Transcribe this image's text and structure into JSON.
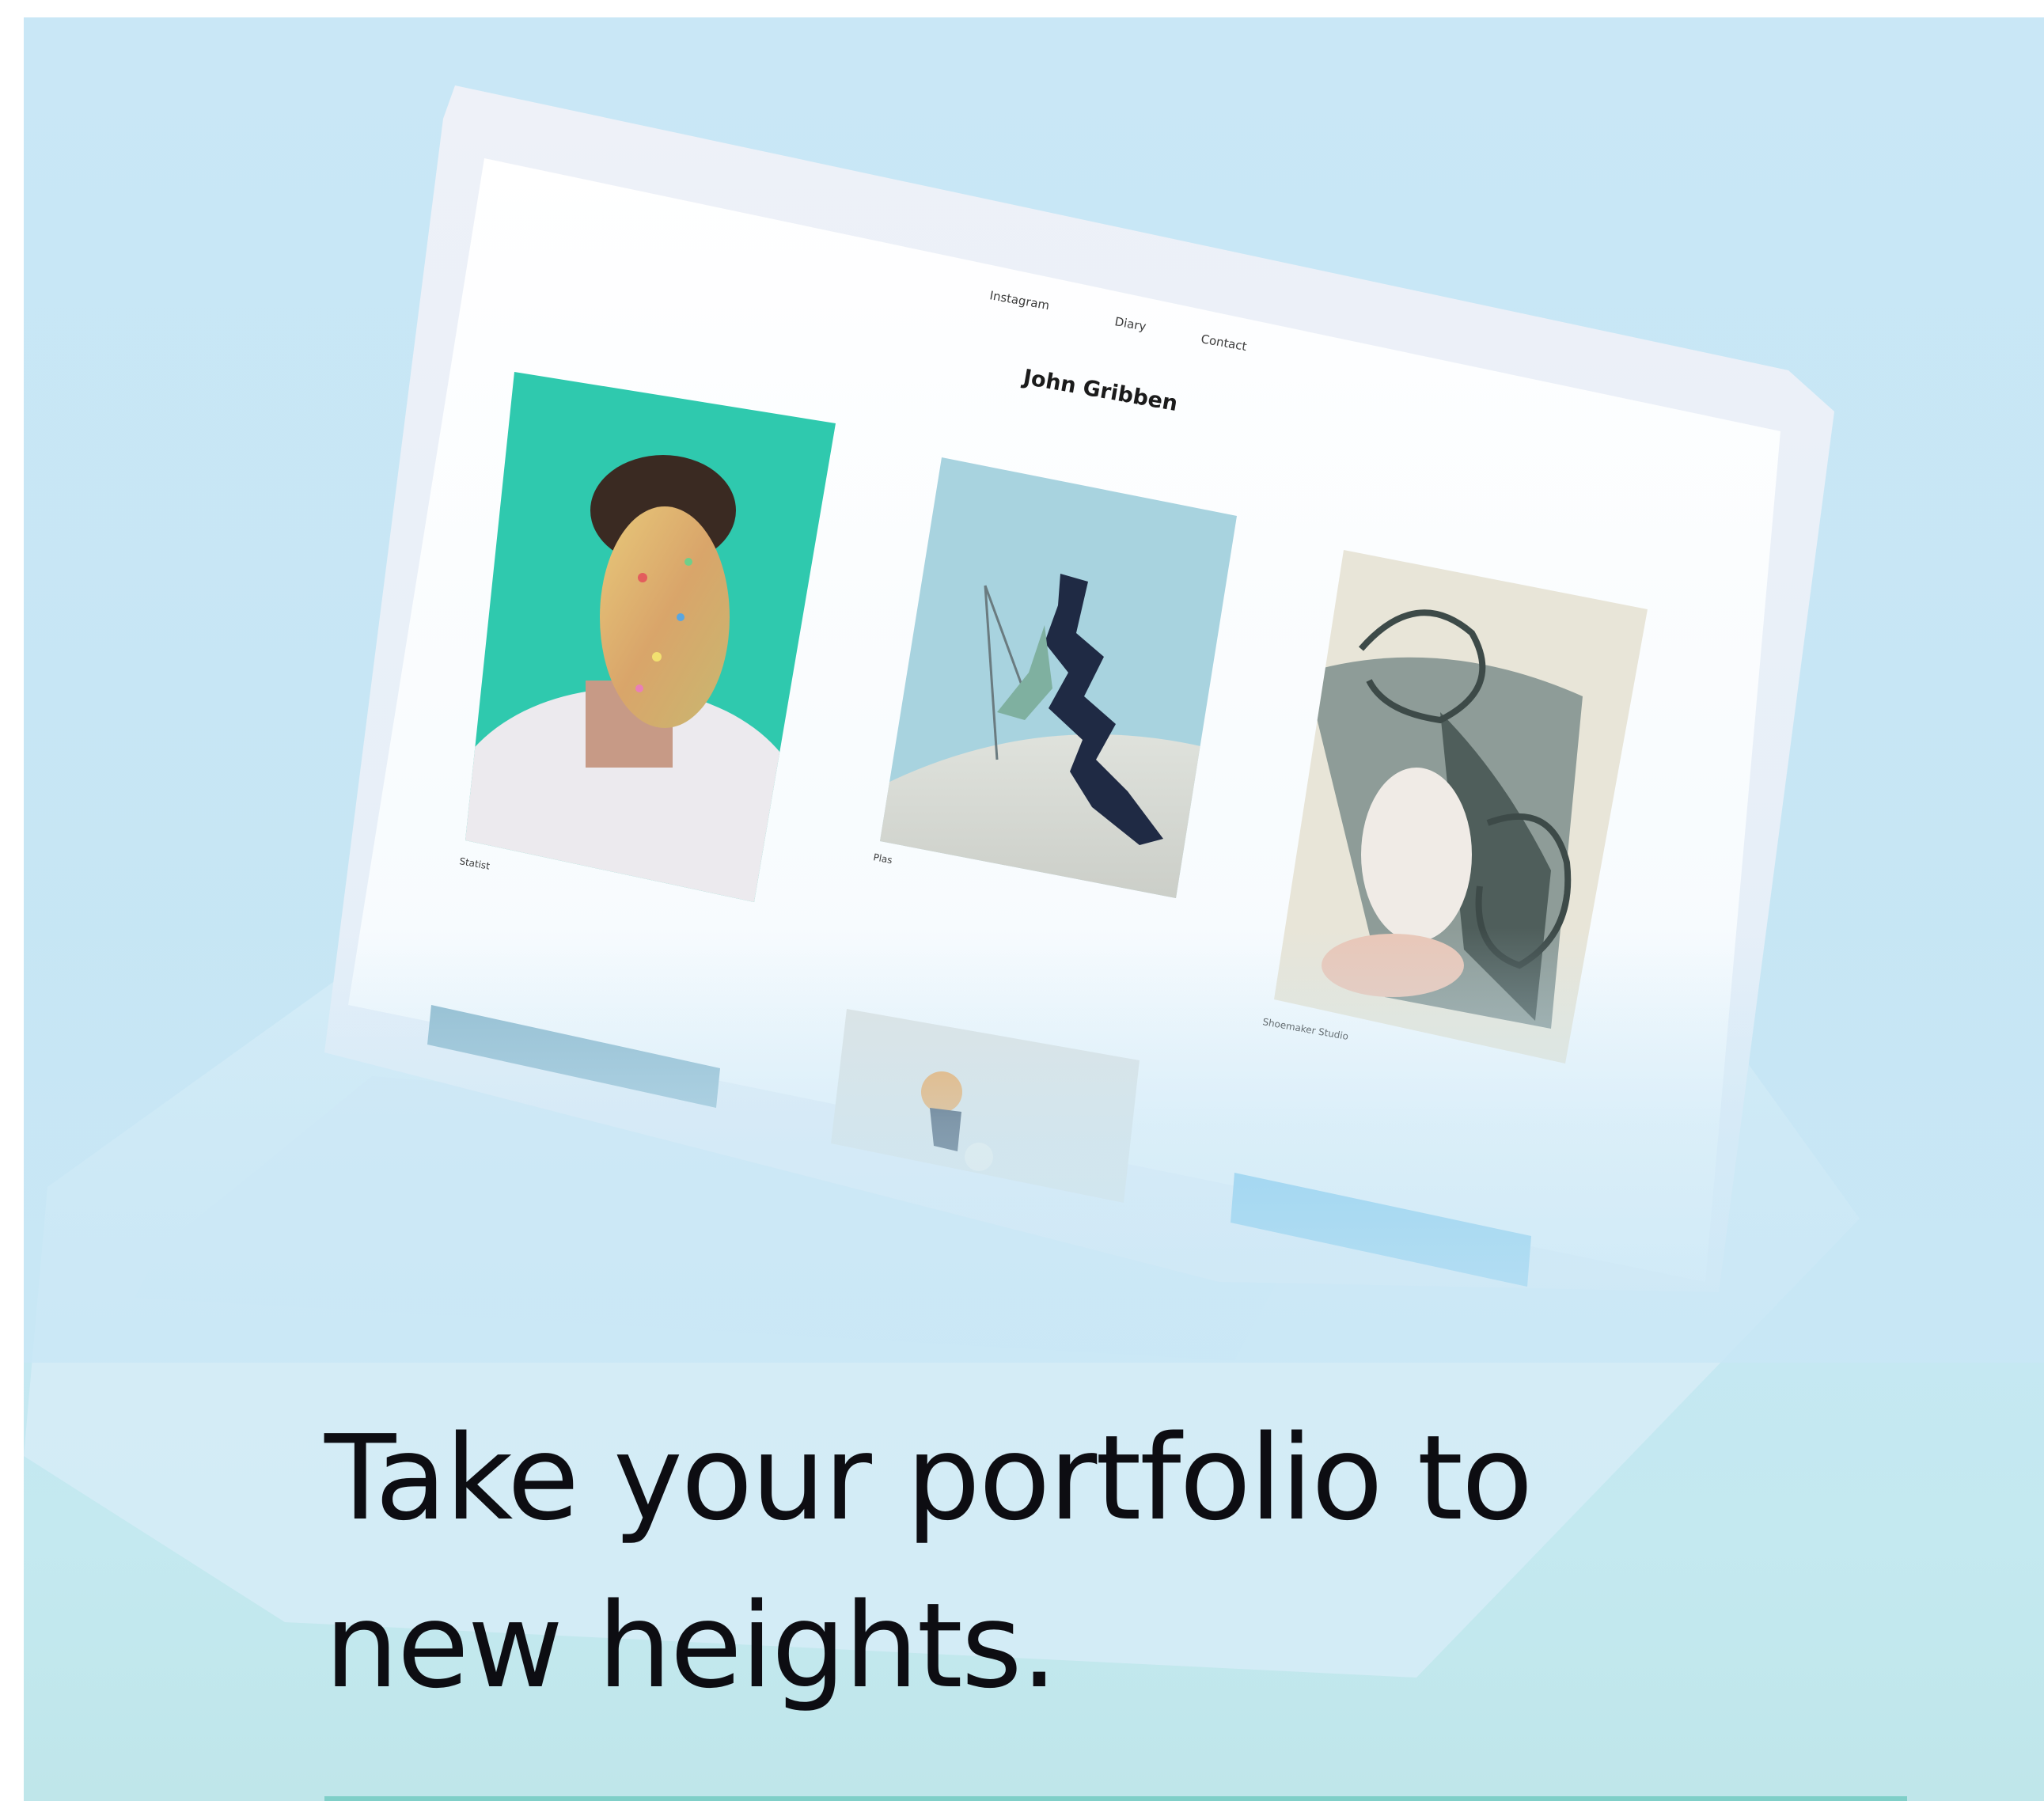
{
  "site": {
    "nav": [
      "Instagram",
      "Diary",
      "Contact"
    ],
    "owner_name": "John Gribben",
    "captions": [
      "Statist",
      "Plas",
      "Shoemaker Studio"
    ]
  },
  "headline": {
    "line1": "Take your portfolio to",
    "line2": "new heights."
  },
  "colors": {
    "background": "#c9e7f6",
    "accent_button": "#6cc0ea",
    "portrait_backdrop": "#2fc9ae",
    "headline_text": "#0d0d12"
  }
}
